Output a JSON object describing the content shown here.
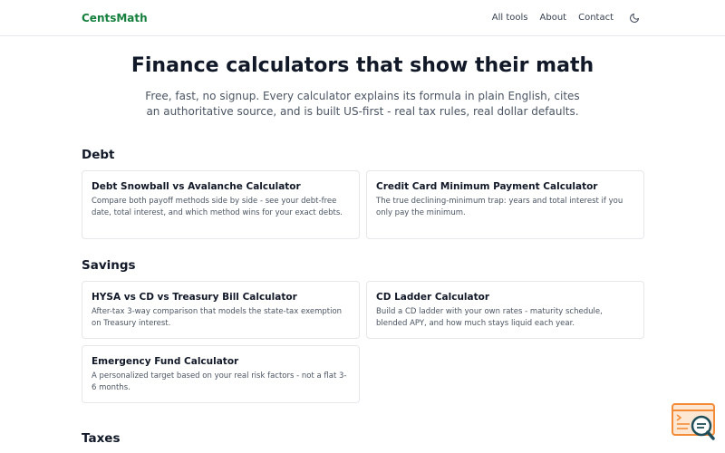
{
  "header": {
    "brand": "CentsMath",
    "nav": [
      {
        "label": "All tools"
      },
      {
        "label": "About"
      },
      {
        "label": "Contact"
      }
    ],
    "theme_icon": "moon-icon"
  },
  "hero": {
    "title": "Finance calculators that show their math",
    "subtitle": "Free, fast, no signup. Every calculator explains its formula in plain English, cites an authoritative source, and is built US-first - real tax rules, real dollar defaults."
  },
  "sections": [
    {
      "title": "Debt",
      "cards": [
        {
          "title": "Debt Snowball vs Avalanche Calculator",
          "desc": "Compare both payoff methods side by side - see your debt-free date, total interest, and which method wins for your exact debts."
        },
        {
          "title": "Credit Card Minimum Payment Calculator",
          "desc": "The true declining-minimum trap: years and total interest if you only pay the minimum."
        }
      ]
    },
    {
      "title": "Savings",
      "cards": [
        {
          "title": "HYSA vs CD vs Treasury Bill Calculator",
          "desc": "After-tax 3-way comparison that models the state-tax exemption on Treasury interest."
        },
        {
          "title": "CD Ladder Calculator",
          "desc": "Build a CD ladder with your own rates - maturity schedule, blended APY, and how much stays liquid each year."
        },
        {
          "title": "Emergency Fund Calculator",
          "desc": "A personalized target based on your real risk factors - not a flat 3-6 months."
        }
      ]
    },
    {
      "title": "Taxes",
      "cards": []
    }
  ],
  "floating_button": {
    "icon": "search-document-icon"
  },
  "colors": {
    "brand": "#15803d",
    "text": "#111827",
    "muted": "#4b5563",
    "border": "#e5e7eb",
    "fab_orange": "#f28c38",
    "fab_teal": "#1f4e5a"
  }
}
